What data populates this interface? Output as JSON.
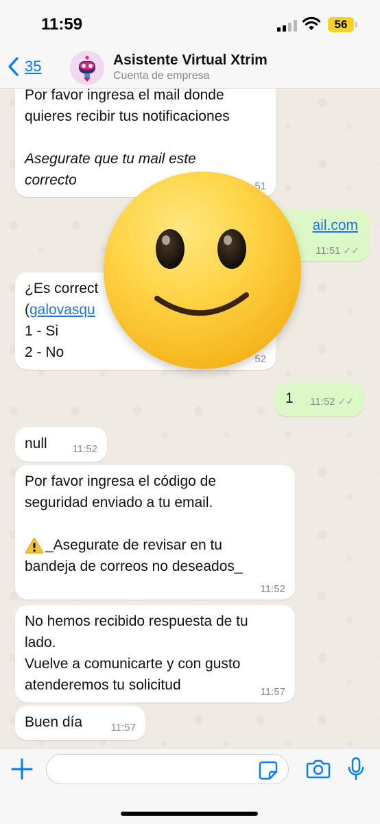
{
  "status": {
    "time": "11:59",
    "battery": "56"
  },
  "header": {
    "back_count": "35",
    "title": "Asistente Virtual Xtrim",
    "subtitle": "Cuenta de empresa"
  },
  "messages": {
    "m1_line1": "Por favor ingresa el mail donde",
    "m1_line2": "quieres recibir tus notificaciones",
    "m1_line3": "Asegurate que tu mail este",
    "m1_line4": "correcto",
    "m1_time": "51",
    "m2_text": "ail.com",
    "m2_time": "11:51",
    "m3_line1": "¿Es correct",
    "m3_paren": "(",
    "m3_link": "galovasqu",
    "m3_line3": "1 - Si",
    "m3_line4": "2 - No",
    "m3_time": "52",
    "m4_text": "1",
    "m4_time": "11:52",
    "m5_text": "null",
    "m5_time": "11:52",
    "m6_line1": "Por favor ingresa el código de",
    "m6_line2": "seguridad enviado a tu email.",
    "m6_line3": "_Asegurate de revisar en tu",
    "m6_line4": "bandeja de correos no deseados_",
    "m6_time": "11:52",
    "m7_line1": "No hemos recibido respuesta de tu",
    "m7_line2": "lado.",
    "m7_line3": "Vuelve a comunicarte y con gusto",
    "m7_line4": "atenderemos tu solicitud",
    "m7_time": "11:57",
    "m8_text": "Buen día",
    "m8_time": "11:57"
  },
  "icons": {
    "back": "chevron-left-icon",
    "add": "plus-icon",
    "sticker": "sticker-icon",
    "camera": "camera-icon",
    "mic": "microphone-icon",
    "warning": "warning-icon",
    "emoji": "smiley-face-icon"
  },
  "colors": {
    "accent": "#007aff",
    "incoming": "#ffffff",
    "outgoing": "#dcf8c6",
    "chat_bg": "#efeae2",
    "link": "#1b74e4"
  }
}
